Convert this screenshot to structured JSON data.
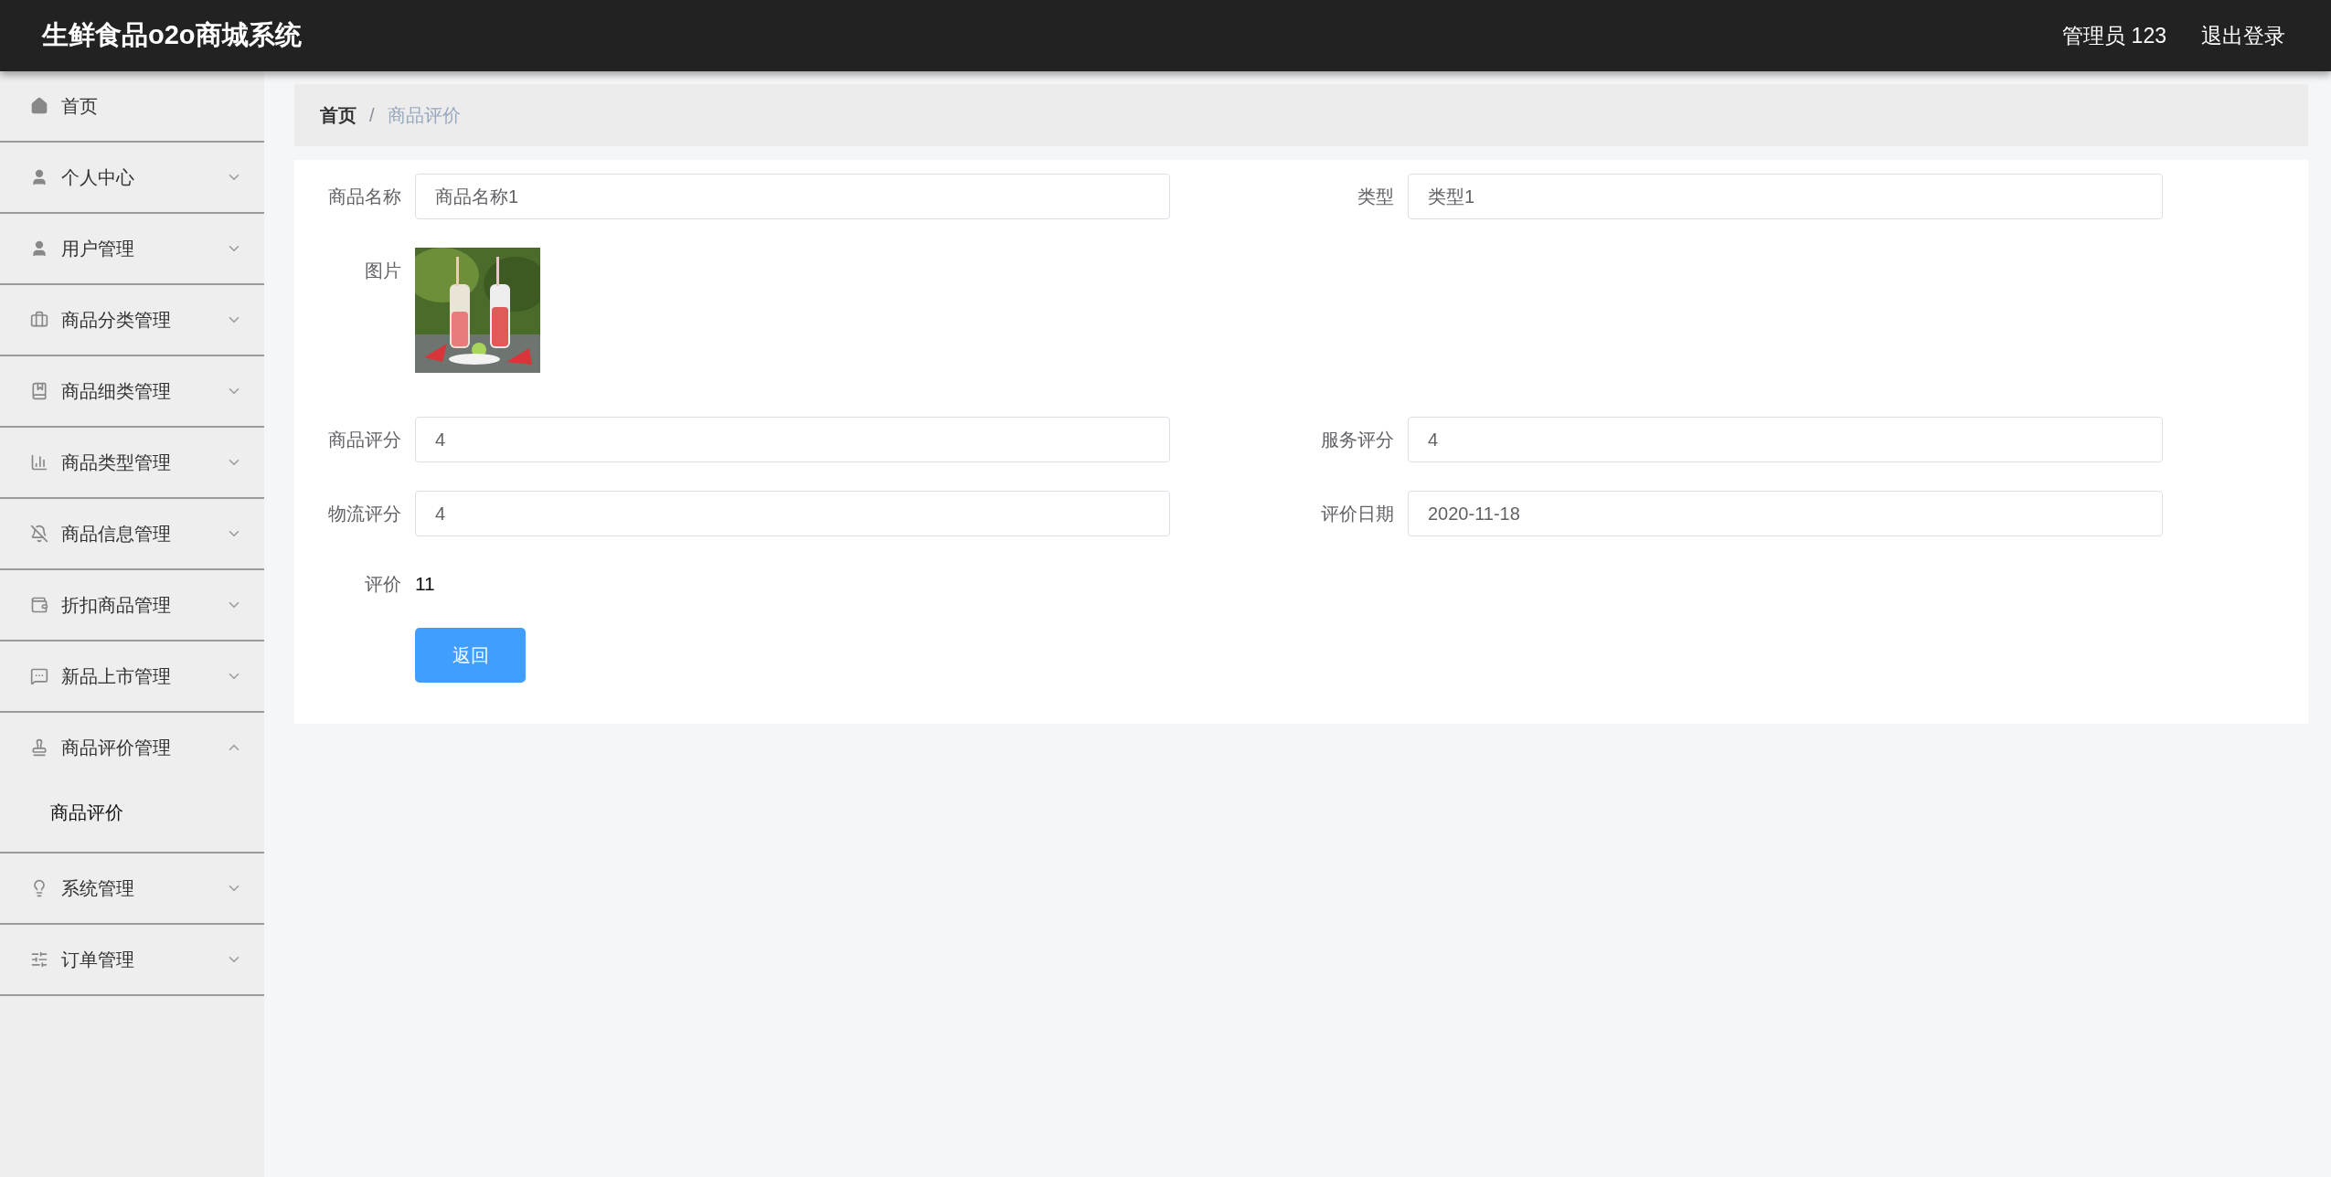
{
  "header": {
    "title": "生鲜食品o2o商城系统",
    "user": "管理员 123",
    "logout": "退出登录"
  },
  "sidebar": {
    "items": [
      {
        "label": "首页",
        "kind": "link"
      },
      {
        "label": "个人中心",
        "kind": "group",
        "expanded": false
      },
      {
        "label": "用户管理",
        "kind": "group",
        "expanded": false
      },
      {
        "label": "商品分类管理",
        "kind": "group",
        "expanded": false
      },
      {
        "label": "商品细类管理",
        "kind": "group",
        "expanded": false
      },
      {
        "label": "商品类型管理",
        "kind": "group",
        "expanded": false
      },
      {
        "label": "商品信息管理",
        "kind": "group",
        "expanded": false
      },
      {
        "label": "折扣商品管理",
        "kind": "group",
        "expanded": false
      },
      {
        "label": "新品上市管理",
        "kind": "group",
        "expanded": false
      },
      {
        "label": "商品评价管理",
        "kind": "group",
        "expanded": true,
        "children": [
          {
            "label": "商品评价"
          }
        ]
      },
      {
        "label": "系统管理",
        "kind": "group",
        "expanded": false
      },
      {
        "label": "订单管理",
        "kind": "group",
        "expanded": false
      }
    ]
  },
  "breadcrumb": {
    "separator": "/",
    "items": [
      {
        "label": "首页",
        "selected": false
      },
      {
        "label": "商品评价",
        "selected": true
      }
    ]
  },
  "form": {
    "rows": [
      {
        "kind": "fields",
        "fields": [
          {
            "label": "商品名称",
            "value": "商品名称1"
          },
          {
            "label": "类型",
            "value": "类型1"
          }
        ]
      },
      {
        "label": "图片"
      },
      {
        "kind": "fields",
        "fields": [
          {
            "label": "商品评分",
            "value": "4"
          },
          {
            "label": "服务评分",
            "value": "4"
          }
        ]
      },
      {
        "kind": "fields",
        "fields": [
          {
            "label": "物流评分",
            "value": "4"
          },
          {
            "label": "评价日期",
            "value": "2020-11-18"
          }
        ]
      },
      {
        "kind": "text",
        "label": "评价",
        "value": "11"
      }
    ],
    "button": "返回"
  }
}
